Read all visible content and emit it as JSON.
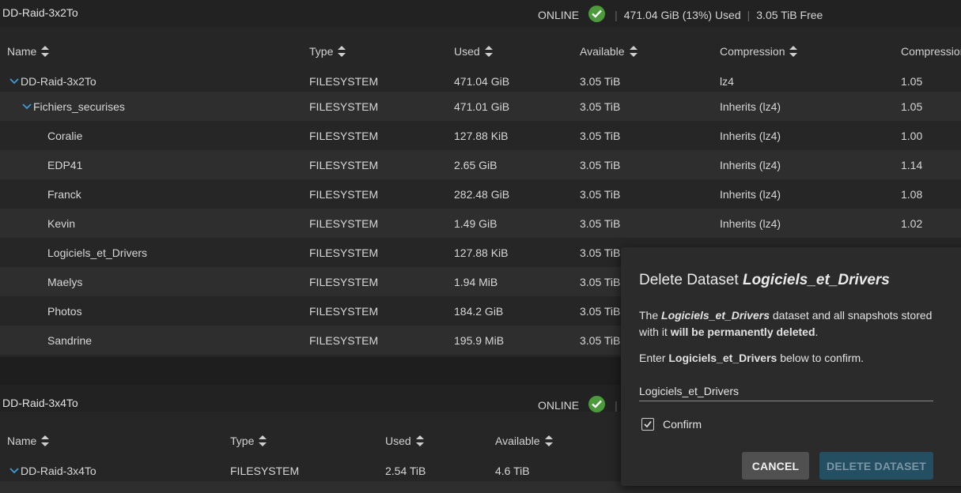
{
  "colors": {
    "ok": "#4c9a3c",
    "accent_chevron": "#3d9bd6",
    "delete_btn_bg": "#244f63"
  },
  "pool1": {
    "name": "DD-Raid-3x2To",
    "status": "ONLINE",
    "used": "471.04 GiB (13%) Used",
    "free": "3.05 TiB Free",
    "columns": [
      "Name",
      "Type",
      "Used",
      "Available",
      "Compression",
      "Compression"
    ],
    "rows": [
      {
        "name": "DD-Raid-3x2To",
        "type": "FILESYSTEM",
        "used": "471.04 GiB",
        "available": "3.05 TiB",
        "compression": "lz4",
        "ratio": "1.05"
      },
      {
        "name": "Fichiers_securises",
        "type": "FILESYSTEM",
        "used": "471.01 GiB",
        "available": "3.05 TiB",
        "compression": "Inherits (lz4)",
        "ratio": "1.05"
      },
      {
        "name": "Coralie",
        "type": "FILESYSTEM",
        "used": "127.88 KiB",
        "available": "3.05 TiB",
        "compression": "Inherits (lz4)",
        "ratio": "1.00"
      },
      {
        "name": "EDP41",
        "type": "FILESYSTEM",
        "used": "2.65 GiB",
        "available": "3.05 TiB",
        "compression": "Inherits (lz4)",
        "ratio": "1.14"
      },
      {
        "name": "Franck",
        "type": "FILESYSTEM",
        "used": "282.48 GiB",
        "available": "3.05 TiB",
        "compression": "Inherits (lz4)",
        "ratio": "1.08"
      },
      {
        "name": "Kevin",
        "type": "FILESYSTEM",
        "used": "1.49 GiB",
        "available": "3.05 TiB",
        "compression": "Inherits (lz4)",
        "ratio": "1.02"
      },
      {
        "name": "Logiciels_et_Drivers",
        "type": "FILESYSTEM",
        "used": "127.88 KiB",
        "available": "3.05 TiB"
      },
      {
        "name": "Maelys",
        "type": "FILESYSTEM",
        "used": "1.94 MiB",
        "available": "3.05 TiB"
      },
      {
        "name": "Photos",
        "type": "FILESYSTEM",
        "used": "184.2 GiB",
        "available": "3.05 TiB"
      },
      {
        "name": "Sandrine",
        "type": "FILESYSTEM",
        "used": "195.9 MiB",
        "available": "3.05 TiB"
      }
    ]
  },
  "pool2": {
    "name": "DD-Raid-3x4To",
    "status": "ONLINE",
    "columns": [
      "Name",
      "Type",
      "Used",
      "Available"
    ],
    "rows": [
      {
        "name": "DD-Raid-3x4To",
        "type": "FILESYSTEM",
        "used": "2.54 TiB",
        "available": "4.6 TiB"
      }
    ]
  },
  "dialog": {
    "title_prefix": "Delete Dataset ",
    "title_name": "Logiciels_et_Drivers",
    "msg_the": "The ",
    "msg_name": "Logiciels_et_Drivers",
    "msg_mid": " dataset and all snapshots stored with it ",
    "msg_bold": "will be permanently deleted",
    "msg_end": ".",
    "enter_prefix": "Enter ",
    "enter_name": "Logiciels_et_Drivers",
    "enter_suffix": " below to confirm.",
    "input_value": "Logiciels_et_Drivers",
    "confirm_label": "Confirm",
    "cancel_label": "CANCEL",
    "delete_label": "DELETE DATASET"
  }
}
